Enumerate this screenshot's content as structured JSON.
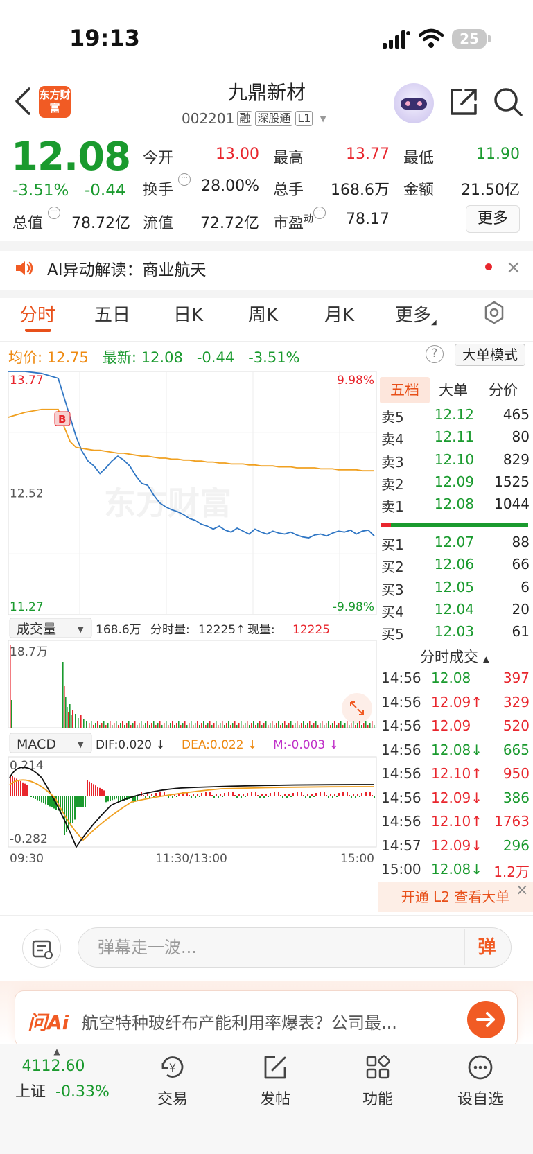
{
  "status": {
    "time": "19:13",
    "battery": "25"
  },
  "header": {
    "logo": "东方财富",
    "name": "九鼎新材",
    "code": "002201",
    "tags": [
      "融",
      "深股通",
      "L1"
    ]
  },
  "quote": {
    "price": "12.08",
    "pct": "-3.51%",
    "change": "-0.44",
    "open_label": "今开",
    "open": "13.00",
    "high_label": "最高",
    "high": "13.77",
    "low_label": "最低",
    "low": "11.90",
    "turnover_label": "换手",
    "turnover": "28.00%",
    "vol_label": "总手",
    "vol": "168.6万",
    "amount_label": "金额",
    "amount": "21.50亿",
    "mcap_label": "总值",
    "mcap": "78.72亿",
    "float_label": "流值",
    "float": "72.72亿",
    "pe_label": "市盈",
    "pe_sup": "动",
    "pe": "78.17",
    "more": "更多"
  },
  "ai": {
    "text": "AI异动解读：商业航天",
    "close": "×"
  },
  "tabs": [
    "分时",
    "五日",
    "日K",
    "周K",
    "月K",
    "更多"
  ],
  "avg": {
    "avg_label": "均价:",
    "avg": "12.75",
    "latest_label": "最新:",
    "latest": "12.08",
    "chg": "-0.44",
    "pct": "-3.51%",
    "help": "?",
    "mode": "大单模式"
  },
  "chart_data": {
    "type": "line",
    "y_top": "13.77",
    "y_mid": "12.52",
    "y_bot": "11.27",
    "pct_top": "9.98%",
    "pct_bot": "-9.98%",
    "x_ticks": [
      "09:30",
      "11:30/13:00",
      "15:00"
    ],
    "watermark": "东方财富",
    "marker": "B",
    "volume": {
      "selector": "成交量",
      "summary_total": "168.6万",
      "summary_label": "分时量:",
      "summary_val": "12225",
      "arrow": "↑",
      "now_label": "现量:",
      "now_val": "12225",
      "max": "18.7万"
    },
    "macd": {
      "selector": "MACD",
      "dif": "DIF:0.020 ↓",
      "dea": "DEA:0.022 ↓",
      "m": "M:-0.003 ↓",
      "top": "0.214",
      "bot": "-0.282"
    },
    "series": [
      {
        "name": "price",
        "values": [
          13.77,
          13.77,
          13.75,
          13.7,
          13.5,
          13.3,
          13.1,
          12.95,
          12.85,
          12.8,
          12.72,
          12.78,
          12.85,
          12.9,
          12.86,
          12.8,
          12.7,
          12.62,
          12.6,
          12.5,
          12.42,
          12.38,
          12.35,
          12.33,
          12.3,
          12.26,
          12.24,
          12.2,
          12.18,
          12.15,
          12.18,
          12.14,
          12.12,
          12.16,
          12.13,
          12.1,
          12.15,
          12.12,
          12.1,
          12.13,
          12.11,
          12.1,
          12.12,
          12.09,
          12.07,
          12.06,
          12.09,
          12.1,
          12.08,
          12.11,
          12.13,
          12.12,
          12.14,
          12.1,
          12.13,
          12.14,
          12.08
        ]
      },
      {
        "name": "avg",
        "values": [
          13.3,
          13.35,
          13.38,
          13.38,
          13.2,
          13.05,
          12.99,
          12.98,
          12.97,
          12.96,
          12.96,
          12.95,
          12.94,
          12.93,
          12.93,
          12.92,
          12.91,
          12.9,
          12.9,
          12.89,
          12.88,
          12.88,
          12.87,
          12.87,
          12.86,
          12.86,
          12.85,
          12.85,
          12.84,
          12.84,
          12.83,
          12.83,
          12.82,
          12.82,
          12.82,
          12.81,
          12.81,
          12.8,
          12.8,
          12.8,
          12.79,
          12.79,
          12.79,
          12.78,
          12.78,
          12.78,
          12.78,
          12.77,
          12.77,
          12.77,
          12.76,
          12.76,
          12.76,
          12.76,
          12.75,
          12.75,
          12.75
        ]
      }
    ]
  },
  "orderbook": {
    "tabs": [
      "五档",
      "大单",
      "分价"
    ],
    "asks": [
      [
        "卖5",
        "12.12",
        "465"
      ],
      [
        "卖4",
        "12.11",
        "80"
      ],
      [
        "卖3",
        "12.10",
        "829"
      ],
      [
        "卖2",
        "12.09",
        "1525"
      ],
      [
        "卖1",
        "12.08",
        "1044"
      ]
    ],
    "bids": [
      [
        "买1",
        "12.07",
        "88"
      ],
      [
        "买2",
        "12.06",
        "66"
      ],
      [
        "买3",
        "12.05",
        "6"
      ],
      [
        "买4",
        "12.04",
        "20"
      ],
      [
        "买5",
        "12.03",
        "61"
      ]
    ],
    "trades_title": "分时成交",
    "trades": [
      [
        "14:56",
        "12.08",
        "397",
        "red"
      ],
      [
        "14:56",
        "12.09↑",
        "329",
        "red"
      ],
      [
        "14:56",
        "12.09",
        "520",
        "red"
      ],
      [
        "14:56",
        "12.08↓",
        "665",
        "green"
      ],
      [
        "14:56",
        "12.10↑",
        "950",
        "red"
      ],
      [
        "14:56",
        "12.09↓",
        "386",
        "green"
      ],
      [
        "14:56",
        "12.10↑",
        "1763",
        "red"
      ],
      [
        "14:57",
        "12.09↓",
        "296",
        "green"
      ],
      [
        "15:00",
        "12.08↓",
        "1.2万",
        "red"
      ]
    ],
    "promo": "开通 L2 查看大单",
    "promo_close": "×"
  },
  "danmu": {
    "placeholder": "弹幕走一波...",
    "btn": "弹"
  },
  "ask": {
    "logo": "问Ai",
    "text": "航空特种玻纤布产能利用率爆表？公司最..."
  },
  "nav": {
    "index_val": "4112.60",
    "index_name": "上证",
    "index_pct": "-0.33%",
    "items": [
      "交易",
      "发帖",
      "功能",
      "设自选"
    ]
  },
  "colors": {
    "up": "#e8262d",
    "down": "#1a9a2e",
    "accent": "#f15b24",
    "avg_line": "#f0a020",
    "price_line": "#2f76c4"
  }
}
